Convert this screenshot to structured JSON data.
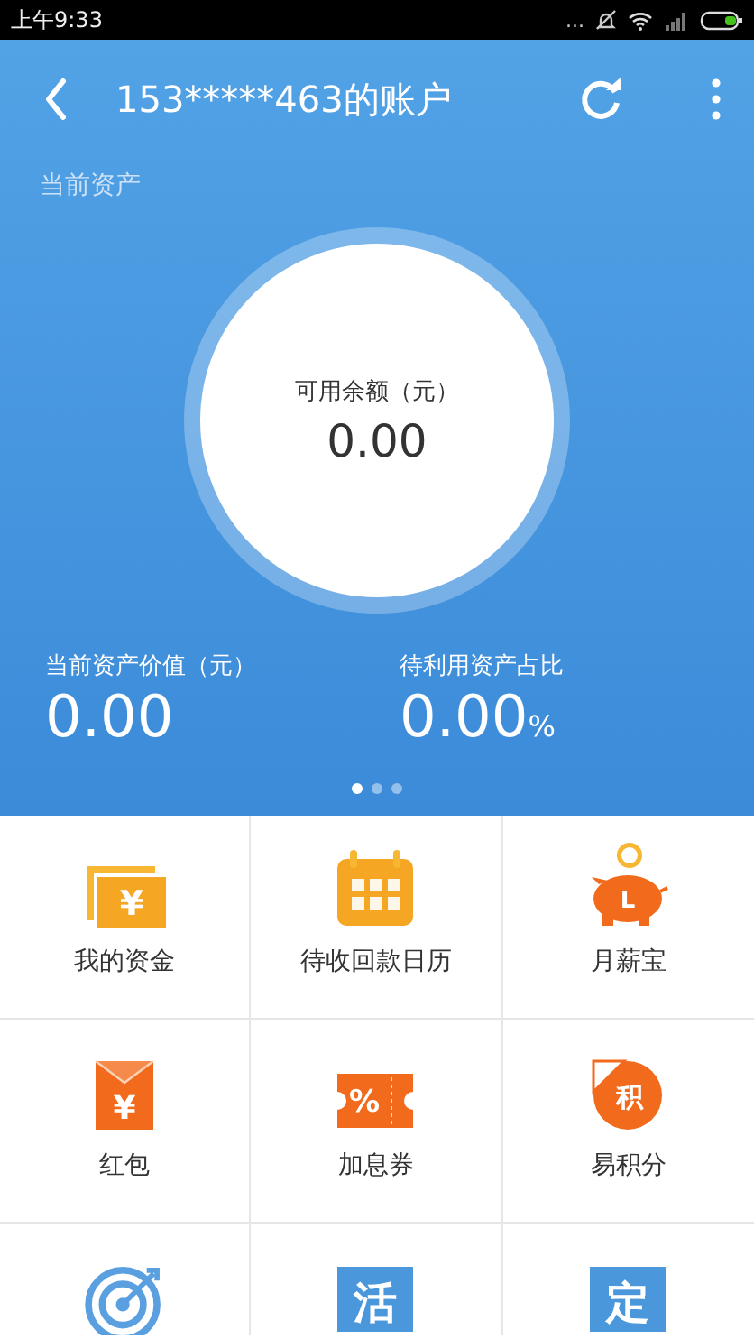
{
  "status_bar": {
    "time": "上午9:33",
    "dots": "..."
  },
  "app_bar": {
    "title": "153*****463的账户"
  },
  "section_label": "当前资产",
  "balance": {
    "label": "可用余额（元）",
    "value": "0.00"
  },
  "stats": [
    {
      "label": "当前资产价值（元）",
      "value": "0.00"
    },
    {
      "label": "待利用资产占比",
      "value": "0.00",
      "unit": "%"
    }
  ],
  "pager": [
    {
      "selected": true
    },
    {
      "selected": false
    },
    {
      "selected": false
    }
  ],
  "menu": [
    {
      "kind": "wallet",
      "glyph": "¥",
      "label": "我的资金"
    },
    {
      "kind": "calendar",
      "label": "待收回款日历"
    },
    {
      "kind": "piggy",
      "glyph": "L",
      "label": "月薪宝"
    },
    {
      "kind": "envelope",
      "glyph": "¥",
      "label": "红包"
    },
    {
      "kind": "ticket",
      "glyph": "%",
      "label": "加息券"
    },
    {
      "kind": "points",
      "glyph": "积",
      "label": "易积分"
    },
    {
      "kind": "target"
    },
    {
      "kind": "tile",
      "glyph": "活"
    },
    {
      "kind": "tile",
      "glyph": "定"
    }
  ]
}
